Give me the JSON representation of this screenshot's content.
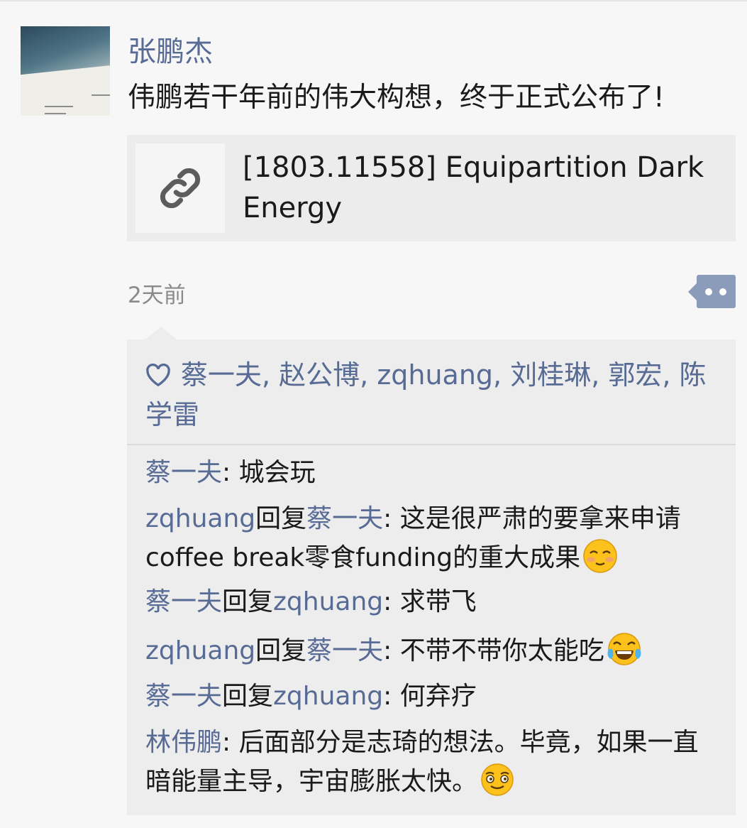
{
  "post": {
    "author": "张鹏杰",
    "text": "伟鹏若干年前的伟大构想，终于正式公布了!",
    "link": {
      "title": "[1803.11558] Equipartition Dark Energy",
      "icon": "link-icon"
    },
    "time": "2天前",
    "more_icon": "more-dots-icon"
  },
  "likes": {
    "icon": "heart-icon",
    "names": "蔡一夫, 赵公博, zqhuang, 刘桂琳, 郭宏, 陈学雷"
  },
  "reply_word": "回复",
  "comments": [
    {
      "author": "蔡一夫",
      "reply_to": "",
      "text": "城会玩",
      "emoji": ""
    },
    {
      "author": "zqhuang",
      "reply_to": "蔡一夫",
      "text": "这是很严肃的要拿来申请coffee break零食funding的重大成果",
      "emoji": "shy-smile-emoji"
    },
    {
      "author": "蔡一夫",
      "reply_to": "zqhuang",
      "text": "求带飞",
      "emoji": ""
    },
    {
      "author": "zqhuang",
      "reply_to": "蔡一夫",
      "text": "不带不带你太能吃",
      "emoji": "tears-of-joy-emoji"
    },
    {
      "author": "蔡一夫",
      "reply_to": "zqhuang",
      "text": "何弃疗",
      "emoji": ""
    },
    {
      "author": "林伟鹏",
      "reply_to": "",
      "text": "后面部分是志琦的想法。毕竟，如果一直暗能量主导，宇宙膨胀太快。",
      "emoji": "grin-emoji"
    }
  ],
  "colors": {
    "name_blue": "#576b95",
    "bubble_bg": "#ededed",
    "page_bg": "#f7f7f7",
    "more_button": "#8b9cbb"
  }
}
